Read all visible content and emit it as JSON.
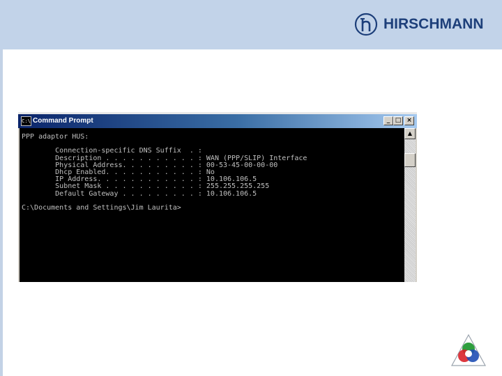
{
  "brand": {
    "name": "HIRSCHMANN",
    "logo_icon": "hirschmann-h-logo-icon",
    "color": "#1d3f7a"
  },
  "header": {
    "background": "#c2d3e9"
  },
  "cmd_window": {
    "title": "Command Prompt",
    "system_icon": "C:\\",
    "buttons": {
      "minimize": "_",
      "maximize": "□",
      "close": "×"
    },
    "console_lines": [
      "PPP adaptor HUS:",
      "",
      "        Connection-specific DNS Suffix  . :",
      "        Description . . . . . . . . . . . : WAN (PPP/SLIP) Interface",
      "        Physical Address. . . . . . . . . : 00-53-45-00-00-00",
      "        Dhcp Enabled. . . . . . . . . . . : No",
      "        IP Address. . . . . . . . . . . . : 10.106.106.5",
      "        Subnet Mask . . . . . . . . . . . : 255.255.255.255",
      "        Default Gateway . . . . . . . . . : 10.106.106.5",
      "",
      "C:\\Documents and Settings\\Jim Laurita>"
    ]
  },
  "corner_logo": {
    "icon": "color-triangle-logo-icon"
  }
}
